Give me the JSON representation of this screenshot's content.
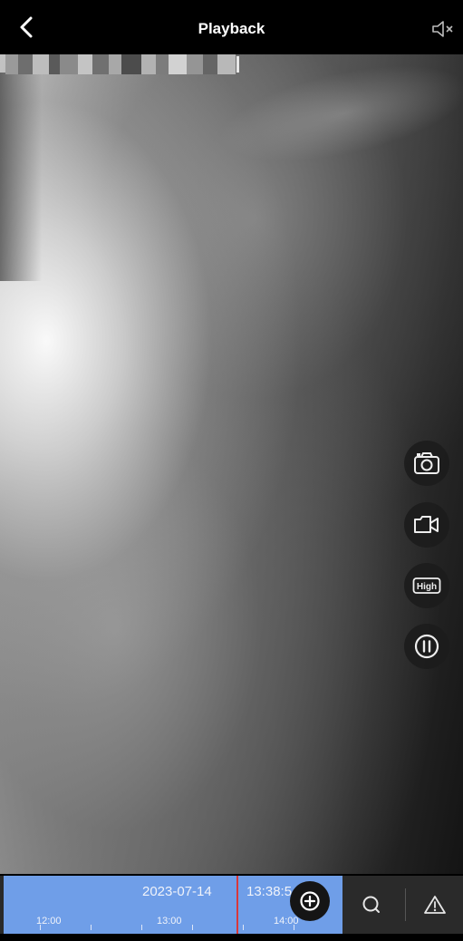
{
  "header": {
    "title": "Playback",
    "back_icon": "chevron-left-icon",
    "mute_icon": "speaker-muted-icon"
  },
  "video": {
    "osd_colors": [
      "#9a9a9a",
      "#6e6e6e",
      "#bdbdbd",
      "#5a5a5a",
      "#8a8a8a",
      "#c4c4c4",
      "#707070",
      "#a8a8a8",
      "#4c4c4c",
      "#b2b2b2",
      "#7c7c7c",
      "#d2d2d2",
      "#959595",
      "#656565",
      "#b8b8b8"
    ]
  },
  "controls": {
    "snapshot_icon": "camera-icon",
    "record_icon": "video-camera-icon",
    "quality_label": "High",
    "pause_icon": "pause-icon"
  },
  "timeline": {
    "date": "2023-07-14",
    "time": "13:38:5",
    "ticks": [
      "12:00",
      "13:00",
      "14:00"
    ],
    "accent_color": "#6f9ee8",
    "cursor_color": "#d8383a",
    "zoom_icon": "zoom-in-icon",
    "search_icon": "search-icon",
    "alert_icon": "warning-icon"
  }
}
